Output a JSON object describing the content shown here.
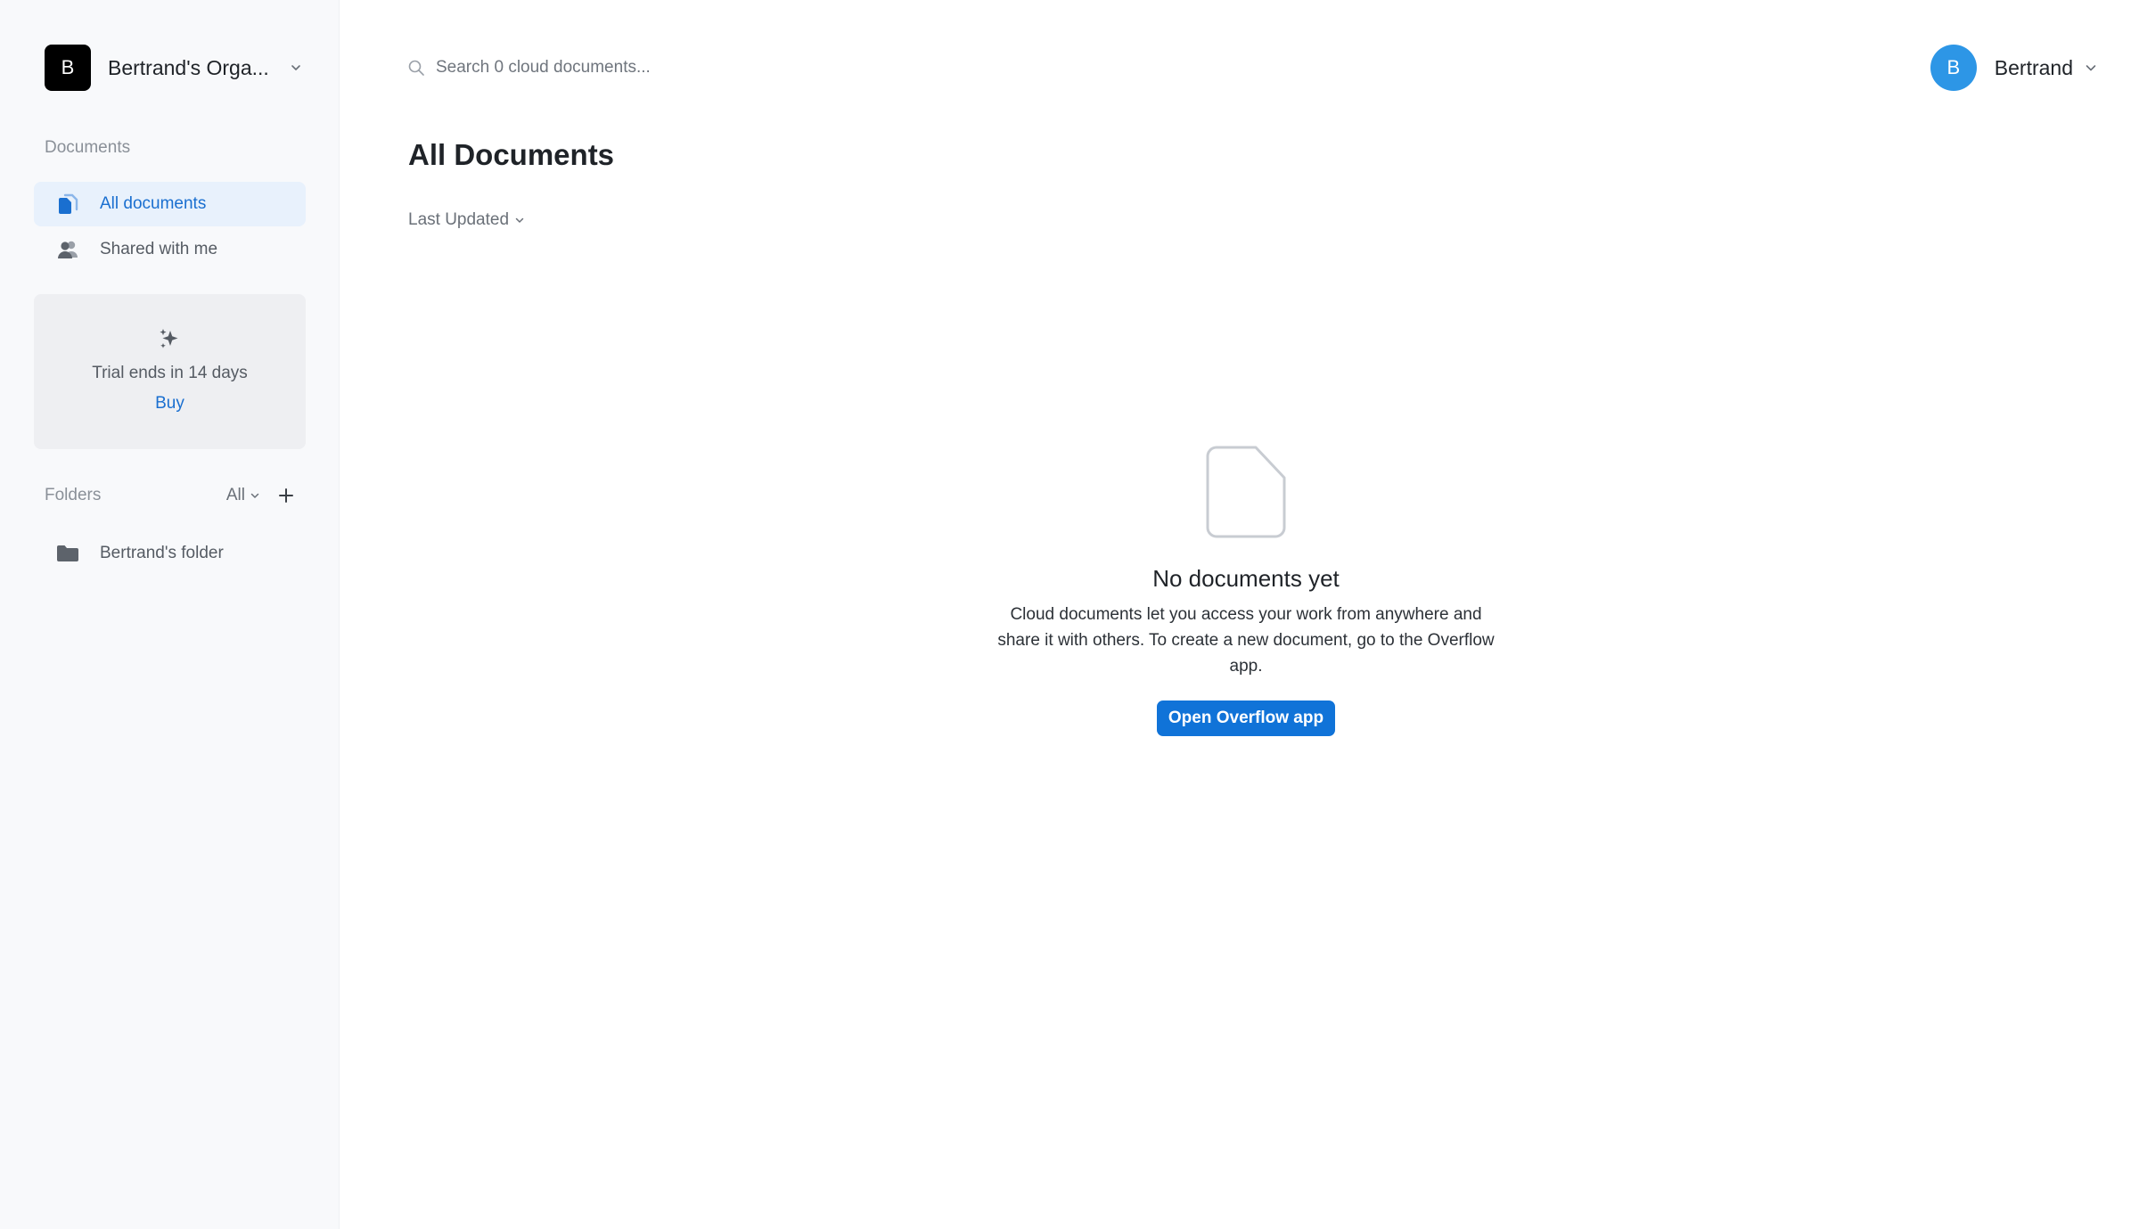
{
  "org": {
    "initial": "B",
    "name": "Bertrand's Orga..."
  },
  "sidebar": {
    "documents_label": "Documents",
    "items": [
      {
        "label": "All documents",
        "icon": "documents-icon",
        "active": true
      },
      {
        "label": "Shared with me",
        "icon": "shared-users-icon",
        "active": false
      }
    ],
    "trial": {
      "text": "Trial ends in 14 days",
      "buy_label": "Buy",
      "icon": "sparkles-icon"
    },
    "folders": {
      "label": "Folders",
      "filter": "All",
      "items": [
        {
          "label": "Bertrand's folder",
          "icon": "folder-icon"
        }
      ]
    }
  },
  "search": {
    "placeholder": "Search 0 cloud documents..."
  },
  "user": {
    "initial": "B",
    "name": "Bertrand"
  },
  "main": {
    "title": "All Documents",
    "sort_label": "Last Updated",
    "empty": {
      "title": "No documents yet",
      "description": "Cloud documents let you access your work from anywhere and share it with others. To create a new document, go to the Overflow app.",
      "button_label": "Open Overflow app",
      "icon": "document-icon"
    }
  },
  "colors": {
    "accent": "#1073d8",
    "avatar_user": "#2d96e6",
    "active_bg": "#e8f1fc"
  }
}
